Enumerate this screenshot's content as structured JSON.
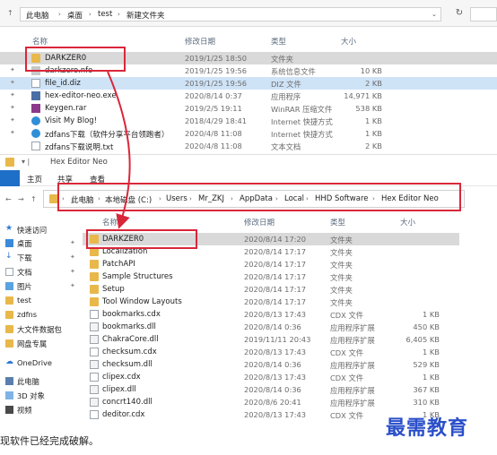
{
  "top_window": {
    "breadcrumb": [
      "此电脑",
      "桌面",
      "test",
      "新建文件夹"
    ],
    "columns": {
      "name": "名称",
      "date": "修改日期",
      "type": "类型",
      "size": "大小"
    },
    "files": [
      {
        "name": "DARKZER0",
        "date": "2019/1/25 18:50",
        "type": "文件夹",
        "size": "",
        "icon": "folder-icon"
      },
      {
        "name": "darkzero.nfo",
        "date": "2019/1/25 19:56",
        "type": "系统信息文件",
        "size": "10 KB",
        "icon": "nfo-file-icon"
      },
      {
        "name": "file_id.diz",
        "date": "2019/1/25 19:56",
        "type": "DIZ 文件",
        "size": "2 KB",
        "icon": "doc-file-icon"
      },
      {
        "name": "hex-editor-neo.exe",
        "date": "2020/8/14 0:37",
        "type": "应用程序",
        "size": "14,971 KB",
        "icon": "exe-file-icon"
      },
      {
        "name": "Keygen.rar",
        "date": "2019/2/5 19:11",
        "type": "WinRAR 压缩文件",
        "size": "538 KB",
        "icon": "rar-file-icon"
      },
      {
        "name": "Visit My Blog!",
        "date": "2018/4/29 18:41",
        "type": "Internet 快捷方式",
        "size": "1 KB",
        "icon": "url-file-icon"
      },
      {
        "name": "zdfans下载（软件分享平台领跑者）",
        "date": "2020/4/8 11:08",
        "type": "Internet 快捷方式",
        "size": "1 KB",
        "icon": "url-file-icon"
      },
      {
        "name": "zdfans下载说明.txt",
        "date": "2020/4/8 11:08",
        "type": "文本文档",
        "size": "2 KB",
        "icon": "doc-file-icon"
      }
    ]
  },
  "second_window": {
    "title": "Hex Editor Neo",
    "ribbon_tabs": [
      "主页",
      "共享",
      "查看"
    ],
    "breadcrumb": [
      "此电脑",
      "本地磁盘 (C:)",
      "Users",
      "Mr_ZKJ",
      "AppData",
      "Local",
      "HHD Software",
      "Hex Editor Neo"
    ],
    "columns": {
      "name": "名称",
      "date": "修改日期",
      "type": "类型",
      "size": "大小"
    },
    "nav_items": [
      {
        "label": "快速访问",
        "icon": "star-icon",
        "pinned": false
      },
      {
        "label": "桌面",
        "icon": "desktop-icon",
        "pinned": true
      },
      {
        "label": "下载",
        "icon": "download-icon",
        "pinned": true
      },
      {
        "label": "文档",
        "icon": "document-icon",
        "pinned": true
      },
      {
        "label": "图片",
        "icon": "picture-icon",
        "pinned": true
      },
      {
        "label": "test",
        "icon": "folder-icon",
        "pinned": false
      },
      {
        "label": "zdfns",
        "icon": "folder-icon",
        "pinned": false
      },
      {
        "label": "大文件数据包",
        "icon": "folder-icon",
        "pinned": false
      },
      {
        "label": "网盘专属",
        "icon": "folder-icon",
        "pinned": false
      },
      {
        "label": "OneDrive",
        "icon": "cloud-icon",
        "pinned": false
      },
      {
        "label": "此电脑",
        "icon": "computer-icon",
        "pinned": false
      },
      {
        "label": "3D 对象",
        "icon": "cube-icon",
        "pinned": false
      },
      {
        "label": "视频",
        "icon": "video-icon",
        "pinned": false
      }
    ],
    "files": [
      {
        "name": "DARKZER0",
        "date": "2020/8/14 17:20",
        "type": "文件夹",
        "size": "",
        "icon": "folder-icon"
      },
      {
        "name": "Localization",
        "date": "2020/8/14 17:17",
        "type": "文件夹",
        "size": "",
        "icon": "folder-icon"
      },
      {
        "name": "PatchAPI",
        "date": "2020/8/14 17:17",
        "type": "文件夹",
        "size": "",
        "icon": "folder-icon"
      },
      {
        "name": "Sample Structures",
        "date": "2020/8/14 17:17",
        "type": "文件夹",
        "size": "",
        "icon": "folder-icon"
      },
      {
        "name": "Setup",
        "date": "2020/8/14 17:17",
        "type": "文件夹",
        "size": "",
        "icon": "folder-icon"
      },
      {
        "name": "Tool Window Layouts",
        "date": "2020/8/14 17:17",
        "type": "文件夹",
        "size": "",
        "icon": "folder-icon"
      },
      {
        "name": "bookmarks.cdx",
        "date": "2020/8/13 17:43",
        "type": "CDX 文件",
        "size": "1 KB",
        "icon": "doc-file-icon"
      },
      {
        "name": "bookmarks.dll",
        "date": "2020/8/14 0:36",
        "type": "应用程序扩展",
        "size": "450 KB",
        "icon": "dll-file-icon"
      },
      {
        "name": "ChakraCore.dll",
        "date": "2019/11/11 20:43",
        "type": "应用程序扩展",
        "size": "6,405 KB",
        "icon": "dll-file-icon"
      },
      {
        "name": "checksum.cdx",
        "date": "2020/8/13 17:43",
        "type": "CDX 文件",
        "size": "1 KB",
        "icon": "doc-file-icon"
      },
      {
        "name": "checksum.dll",
        "date": "2020/8/14 0:36",
        "type": "应用程序扩展",
        "size": "529 KB",
        "icon": "dll-file-icon"
      },
      {
        "name": "clipex.cdx",
        "date": "2020/8/13 17:43",
        "type": "CDX 文件",
        "size": "1 KB",
        "icon": "doc-file-icon"
      },
      {
        "name": "clipex.dll",
        "date": "2020/8/14 0:36",
        "type": "应用程序扩展",
        "size": "367 KB",
        "icon": "dll-file-icon"
      },
      {
        "name": "concrt140.dll",
        "date": "2020/8/6 20:41",
        "type": "应用程序扩展",
        "size": "310 KB",
        "icon": "dll-file-icon"
      },
      {
        "name": "deditor.cdx",
        "date": "2020/8/13 17:43",
        "type": "CDX 文件",
        "size": "1 KB",
        "icon": "doc-file-icon"
      }
    ]
  },
  "caption": "现软件已经完成破解。",
  "brand": "最需教育",
  "colors": {
    "highlight_red": "#d9273a",
    "brand_blue": "#2a4fc9",
    "folder": "#e8b84a"
  }
}
